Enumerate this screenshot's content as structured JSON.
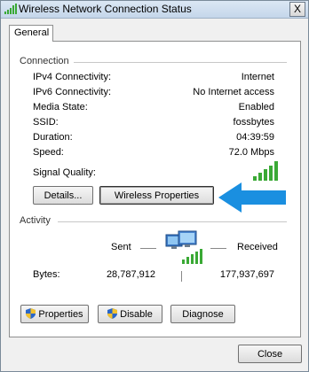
{
  "window": {
    "title": "Wireless Network Connection Status",
    "close_glyph": "X"
  },
  "tabs": [
    {
      "label": "General"
    }
  ],
  "connection": {
    "group_label": "Connection",
    "rows": [
      {
        "label": "IPv4 Connectivity:",
        "value": "Internet"
      },
      {
        "label": "IPv6 Connectivity:",
        "value": "No Internet access"
      },
      {
        "label": "Media State:",
        "value": "Enabled"
      },
      {
        "label": "SSID:",
        "value": "fossbytes"
      },
      {
        "label": "Duration:",
        "value": "04:39:59"
      },
      {
        "label": "Speed:",
        "value": "72.0 Mbps"
      }
    ],
    "signal_label": "Signal Quality:",
    "signal_bars_filled": 5,
    "details_button": "Details...",
    "wireless_properties_button": "Wireless Properties"
  },
  "activity": {
    "group_label": "Activity",
    "sent_label": "Sent",
    "received_label": "Received",
    "bytes_label": "Bytes:",
    "bytes_sent": "28,787,912",
    "bytes_received": "177,937,697"
  },
  "actions": {
    "properties_button": "Properties",
    "disable_button": "Disable",
    "diagnose_button": "Diagnose"
  },
  "footer": {
    "close_button": "Close"
  },
  "colors": {
    "arrow": "#1a8fe0",
    "signal": "#3aa935",
    "title_gradient_top": "#dbe7f4"
  },
  "icons": [
    "wifi-signal-icon",
    "close-icon",
    "signal-strength-icon",
    "blue-arrow-icon",
    "network-computers-icon",
    "uac-shield-icon"
  ]
}
